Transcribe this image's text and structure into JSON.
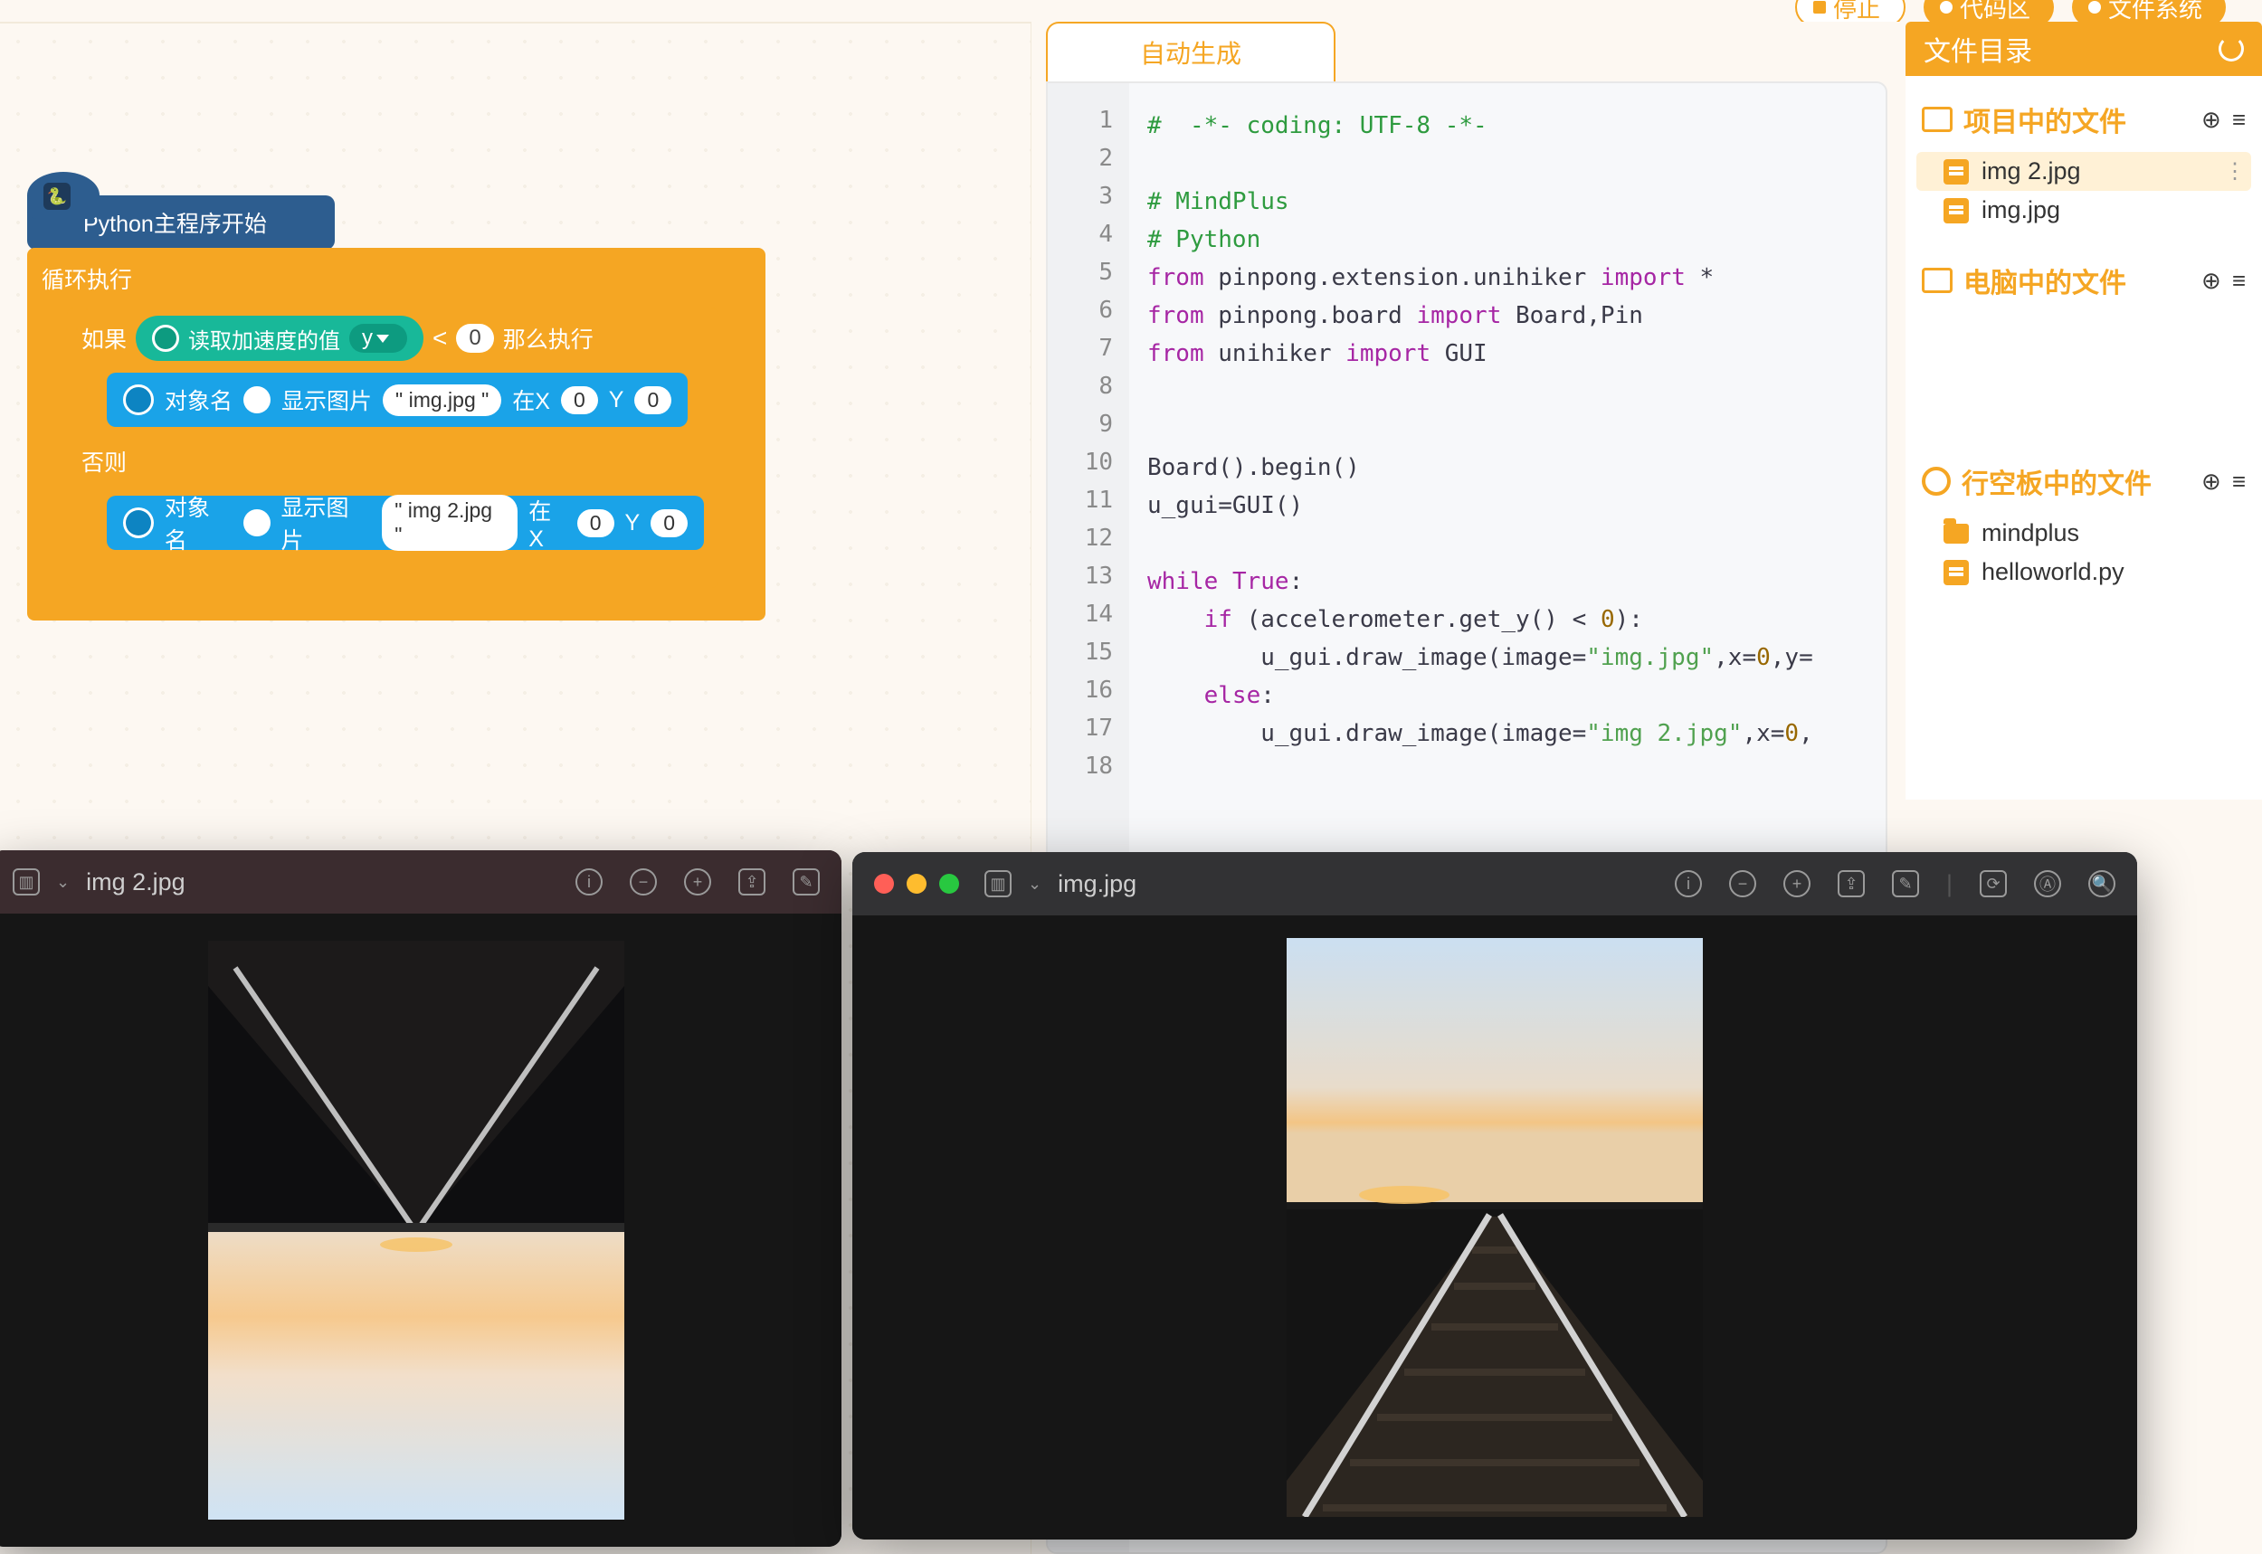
{
  "topbar": {
    "stop": "停止",
    "code": "代码区",
    "files": "文件系统"
  },
  "sidebar": {
    "title": "文件目录",
    "section_project": "项目中的文件",
    "section_computer": "电脑中的文件",
    "section_unihiker": "行空板中的文件",
    "files_project": [
      "img 2.jpg",
      "img.jpg"
    ],
    "files_unihiker": [
      {
        "name": "mindplus",
        "type": "folder"
      },
      {
        "name": "helloworld.py",
        "type": "file"
      }
    ]
  },
  "tab": {
    "auto_generate": "自动生成"
  },
  "blocks": {
    "hat": "Python主程序开始",
    "loop": "循环执行",
    "if_label": "如果",
    "then_label": "那么执行",
    "else_label": "否则",
    "sensor_label": "读取加速度的值",
    "axis": "y",
    "cmp": "<",
    "zero": "0",
    "obj_label": "对象名",
    "show_label": "显示图片",
    "img1_str": "\" img.jpg \"",
    "img2_str": "\" img 2.jpg \"",
    "atX": "在X",
    "Y": "Y",
    "coord0": "0"
  },
  "code": {
    "lines": [
      {
        "n": 1,
        "html": "<span class='c-comment'>#  -*- coding: UTF-8 -*-</span>"
      },
      {
        "n": 2,
        "html": ""
      },
      {
        "n": 3,
        "html": "<span class='c-comment'># MindPlus</span>"
      },
      {
        "n": 4,
        "html": "<span class='c-comment'># Python</span>"
      },
      {
        "n": 5,
        "html": "<span class='c-kw'>from</span> pinpong.extension.unihiker <span class='c-kw'>import</span> *"
      },
      {
        "n": 6,
        "html": "<span class='c-kw'>from</span> pinpong.board <span class='c-kw'>import</span> Board,Pin"
      },
      {
        "n": 7,
        "html": "<span class='c-kw'>from</span> unihiker <span class='c-kw'>import</span> GUI"
      },
      {
        "n": 8,
        "html": ""
      },
      {
        "n": 9,
        "html": ""
      },
      {
        "n": 10,
        "html": "Board().begin()"
      },
      {
        "n": 11,
        "html": "u_gui=GUI()"
      },
      {
        "n": 12,
        "html": ""
      },
      {
        "n": 13,
        "html": "<span class='c-kw'>while</span> <span class='c-kw'>True</span>:"
      },
      {
        "n": 14,
        "html": "    <span class='c-kw'>if</span> (accelerometer.get_y() &lt; <span class='c-num'>0</span>):"
      },
      {
        "n": 15,
        "html": "        u_gui.draw_image(image=<span class='c-str2'>\"img.jpg\"</span>,x=<span class='c-num'>0</span>,y="
      },
      {
        "n": 16,
        "html": "    <span class='c-kw'>else</span>:"
      },
      {
        "n": 17,
        "html": "        u_gui.draw_image(image=<span class='c-str2'>\"img 2.jpg\"</span>,x=<span class='c-num'>0</span>,"
      },
      {
        "n": 18,
        "html": ""
      }
    ]
  },
  "preview": {
    "a_title": "img 2.jpg",
    "b_title": "img.jpg"
  }
}
